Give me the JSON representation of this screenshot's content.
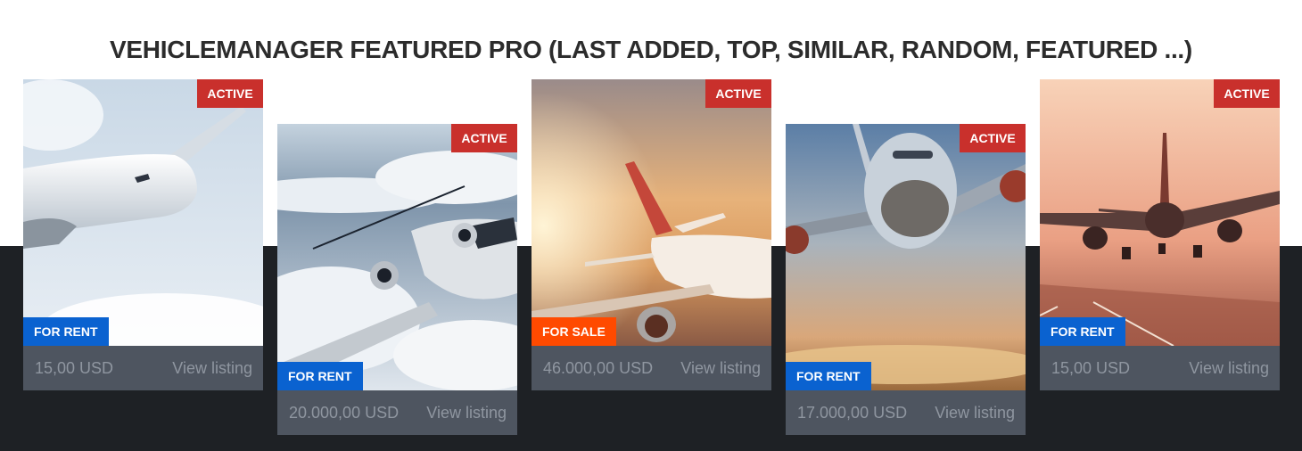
{
  "module": {
    "title": "VEHICLEMANAGER FEATURED PRO (LAST ADDED, TOP, SIMILAR, RANDOM, FEATURED ...)"
  },
  "colors": {
    "active_badge": "#c9302c",
    "for_rent_badge": "#0a62d0",
    "for_sale_badge": "#ff4a00",
    "card_footer": "#4e5560",
    "dark_band": "#1e2125"
  },
  "listings": [
    {
      "status": "ACTIVE",
      "type": "FOR RENT",
      "type_color": "#0a62d0",
      "price": "15,00 USD",
      "link_label": "View listing",
      "image": "airliner-in-clouds"
    },
    {
      "status": "ACTIVE",
      "type": "FOR RENT",
      "type_color": "#0a62d0",
      "price": "20.000,00 USD",
      "link_label": "View listing",
      "image": "private-jet-above-clouds"
    },
    {
      "status": "ACTIVE",
      "type": "FOR SALE",
      "type_color": "#ff4a00",
      "price": "46.000,00 USD",
      "link_label": "View listing",
      "image": "airliner-at-sunset"
    },
    {
      "status": "ACTIVE",
      "type": "FOR RENT",
      "type_color": "#0a62d0",
      "price": "17.000,00 USD",
      "link_label": "View listing",
      "image": "airliner-front-view"
    },
    {
      "status": "ACTIVE",
      "type": "FOR RENT",
      "type_color": "#0a62d0",
      "price": "15,00 USD",
      "link_label": "View listing",
      "image": "airliner-landing-runway"
    }
  ]
}
